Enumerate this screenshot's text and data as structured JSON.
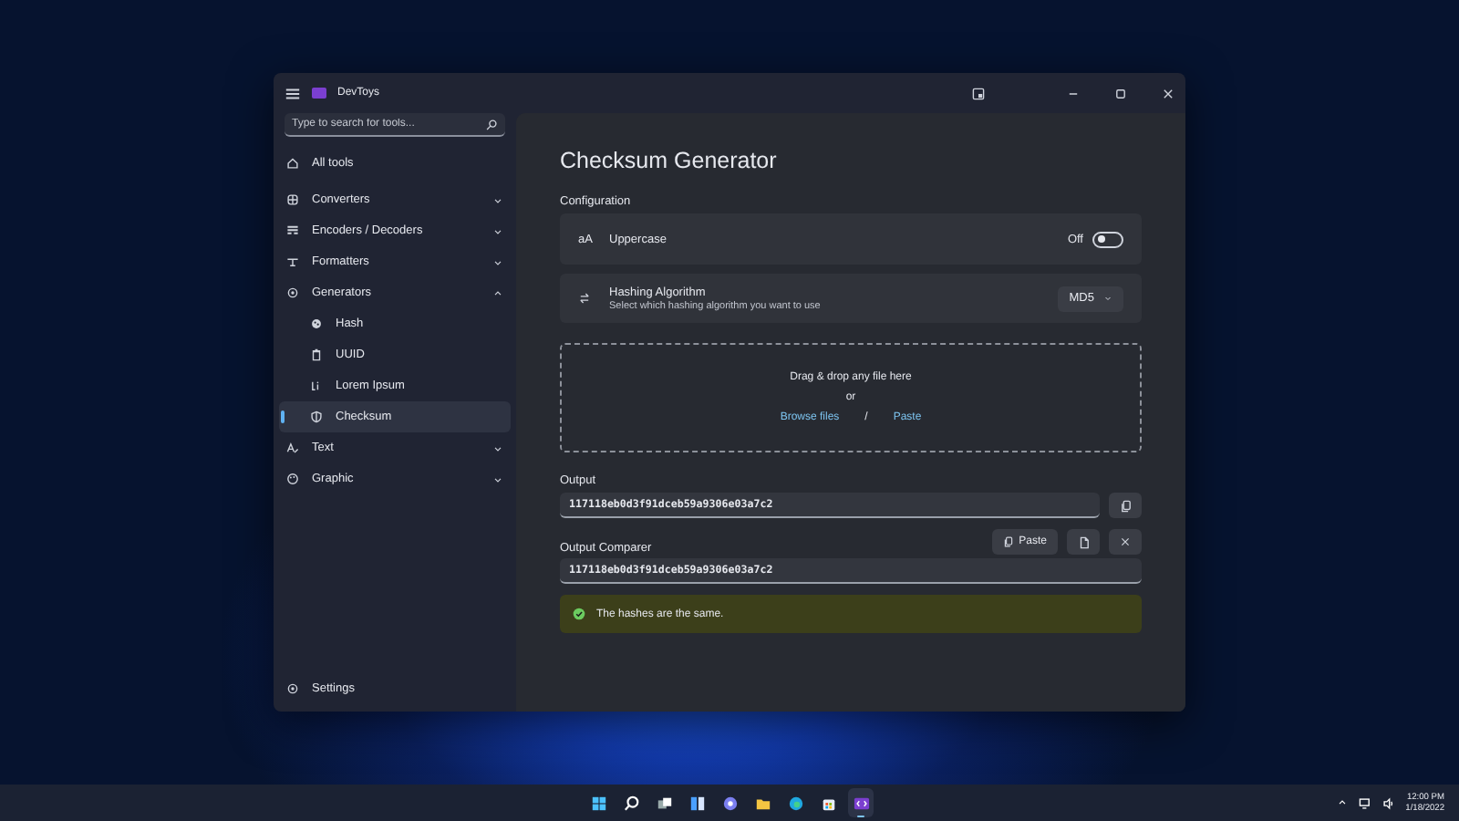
{
  "window": {
    "title": "DevToys"
  },
  "sidebar": {
    "search": {
      "placeholder": "Type to search for tools..."
    },
    "items": [
      {
        "kind": "link",
        "label": "All tools",
        "selected": false
      },
      {
        "kind": "group",
        "label": "Converters",
        "expanded": false,
        "selected": false
      },
      {
        "kind": "group",
        "label": "Encoders / Decoders",
        "expanded": false,
        "selected": false
      },
      {
        "kind": "group",
        "label": "Formatters",
        "expanded": false,
        "selected": false
      },
      {
        "kind": "group",
        "label": "Generators",
        "expanded": true,
        "selected": false,
        "children": [
          {
            "label": "Hash",
            "selected": false
          },
          {
            "label": "UUID",
            "selected": false
          },
          {
            "label": "Lorem Ipsum",
            "selected": false
          },
          {
            "label": "Checksum",
            "selected": true
          }
        ]
      },
      {
        "kind": "group",
        "label": "Text",
        "expanded": false,
        "selected": false
      },
      {
        "kind": "group",
        "label": "Graphic",
        "expanded": false,
        "selected": false
      }
    ],
    "footer": {
      "label": "Settings"
    }
  },
  "content": {
    "title": "Checksum Generator",
    "configuration": {
      "heading": "Configuration",
      "settings": [
        {
          "kind": "toggle",
          "icon_text": "aA",
          "title": "Uppercase",
          "state_label": "Off",
          "on": false
        },
        {
          "kind": "dropdown",
          "title": "Hashing Algorithm",
          "description": "Select which hashing algorithm you want to use",
          "value": "MD5"
        }
      ]
    },
    "drop_zone": {
      "text": "Drag & drop any file here",
      "or": "or",
      "browse": "Browse files",
      "separator": "/",
      "paste": "Paste"
    },
    "output": {
      "label": "Output",
      "value": "117118eb0d3f91dceb59a9306e03a7c2"
    },
    "comparer": {
      "label": "Output Comparer",
      "paste_button": "Paste",
      "value": "117118eb0d3f91dceb59a9306e03a7c2"
    },
    "result": {
      "text": "The hashes are the same.",
      "match": true
    }
  },
  "taskbar": {
    "time": "12:00 PM",
    "date": "1/18/2022"
  }
}
